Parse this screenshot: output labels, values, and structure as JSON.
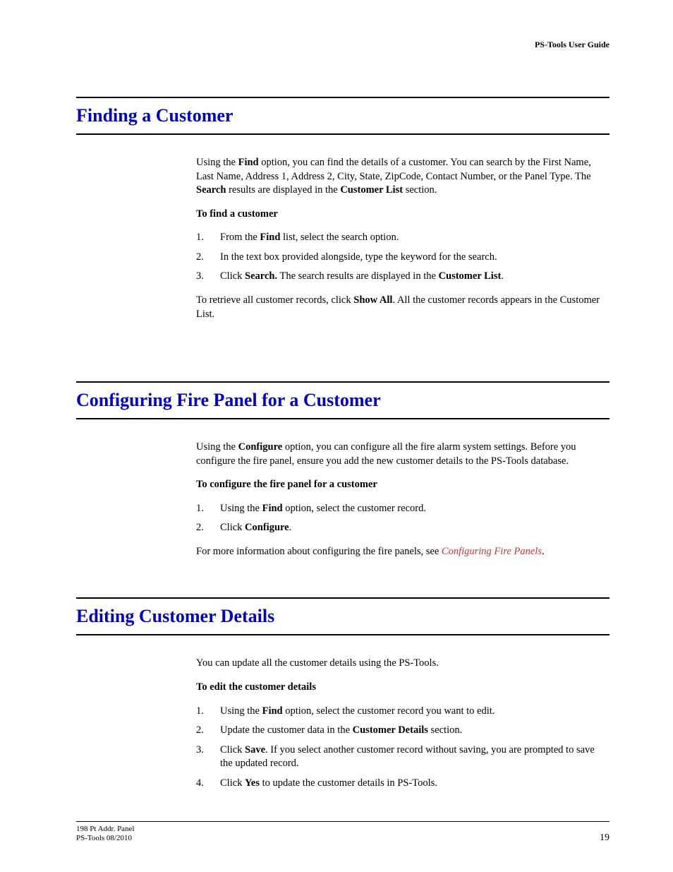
{
  "header": {
    "doc_title": "PS-Tools User Guide"
  },
  "sections": [
    {
      "heading": "Finding a Customer",
      "intro_parts": [
        "Using the ",
        {
          "b": "Find"
        },
        " option, you can find the details of a customer. You can search by the First Name, Last Name, Address 1, Address 2, City, State, ZipCode, Contact Number, or the Panel Type. The ",
        {
          "b": "Search"
        },
        " results are displayed in the ",
        {
          "b": "Customer List"
        },
        " section."
      ],
      "subheading": "To find a customer",
      "steps": [
        [
          "From the ",
          {
            "b": "Find"
          },
          " list, select the search option."
        ],
        [
          "In the text box provided alongside, type the keyword for the search."
        ],
        [
          "Click ",
          {
            "b": "Search."
          },
          " The search results are displayed in the ",
          {
            "b": "Customer List"
          },
          "."
        ]
      ],
      "outro_parts": [
        "To retrieve all customer records, click ",
        {
          "b": "Show All"
        },
        ". All the customer records appears in the Customer List."
      ]
    },
    {
      "heading": "Configuring Fire Panel for a Customer",
      "intro_parts": [
        "Using the ",
        {
          "b": "Configure"
        },
        " option, you can configure all the fire alarm system settings. Before you configure the fire panel, ensure you add the new customer details to the PS-Tools database."
      ],
      "subheading": "To configure the fire panel for a customer",
      "steps": [
        [
          "Using the ",
          {
            "b": "Find"
          },
          " option, select the customer record."
        ],
        [
          "Click ",
          {
            "b": "Configure"
          },
          "."
        ]
      ],
      "outro_parts": [
        "For more information about configuring the fire panels, see ",
        {
          "link": "Configuring Fire Panels"
        },
        "."
      ]
    },
    {
      "heading": "Editing Customer Details",
      "intro_parts": [
        "You can update all the customer details using the PS-Tools."
      ],
      "subheading": "To edit the customer details",
      "steps": [
        [
          "Using the ",
          {
            "b": "Find"
          },
          " option, select the customer record you want to edit."
        ],
        [
          "Update the customer data in the ",
          {
            "b": "Customer Details"
          },
          " section."
        ],
        [
          "Click ",
          {
            "b": "Save"
          },
          ". If you select another customer record without saving, you are prompted to save the updated record."
        ],
        [
          "Click ",
          {
            "b": "Yes"
          },
          " to update the customer details in PS-Tools."
        ]
      ]
    }
  ],
  "footer": {
    "line1": "198 Pt Addr. Panel",
    "line2": "PS-Tools  08/2010",
    "page_number": "19"
  }
}
